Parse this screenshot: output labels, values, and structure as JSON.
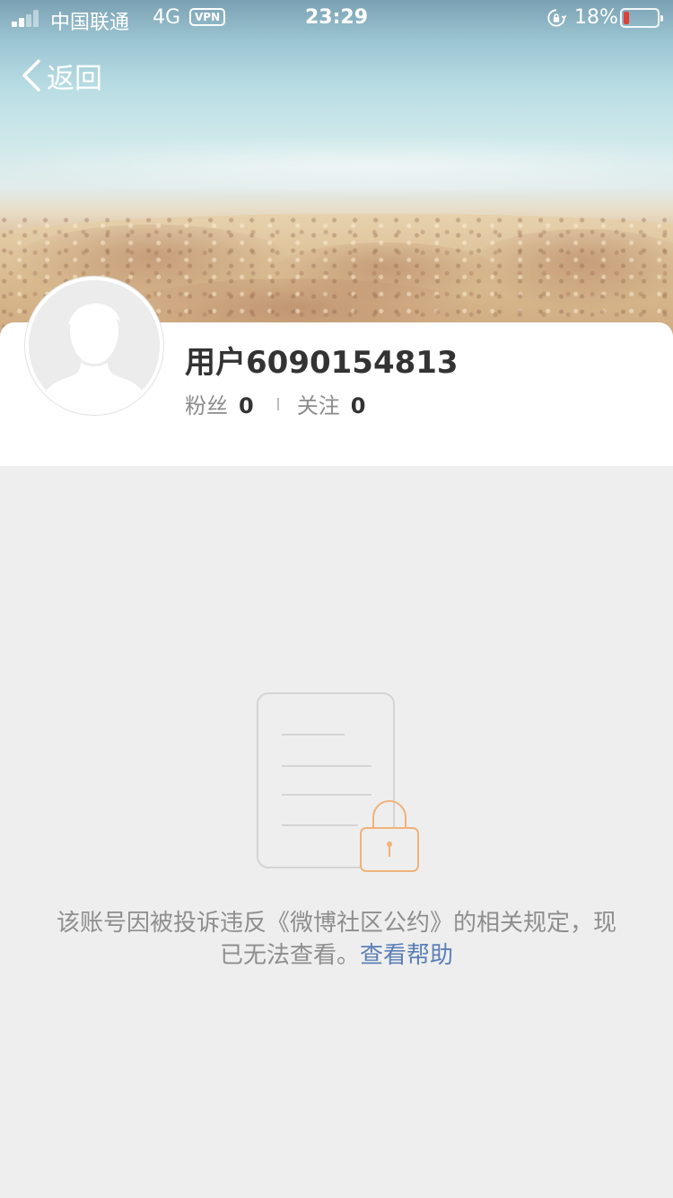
{
  "status_bar": {
    "carrier": "中国联通",
    "network": "4G",
    "vpn": "VPN",
    "time": "23:29",
    "battery_percent": "18%",
    "battery_level": 0.18
  },
  "nav": {
    "back_label": "返回"
  },
  "profile": {
    "username": "用户6090154813",
    "followers_label": "粉丝",
    "followers_count": "0",
    "following_label": "关注",
    "following_count": "0"
  },
  "notice": {
    "message": "该账号因被投诉违反《微博社区公约》的相关规定，现已无法查看。",
    "help_link": "查看帮助"
  },
  "colors": {
    "link": "#5b7fb6",
    "lock_accent": "#f0b27a",
    "battery_low": "#e0403a"
  }
}
